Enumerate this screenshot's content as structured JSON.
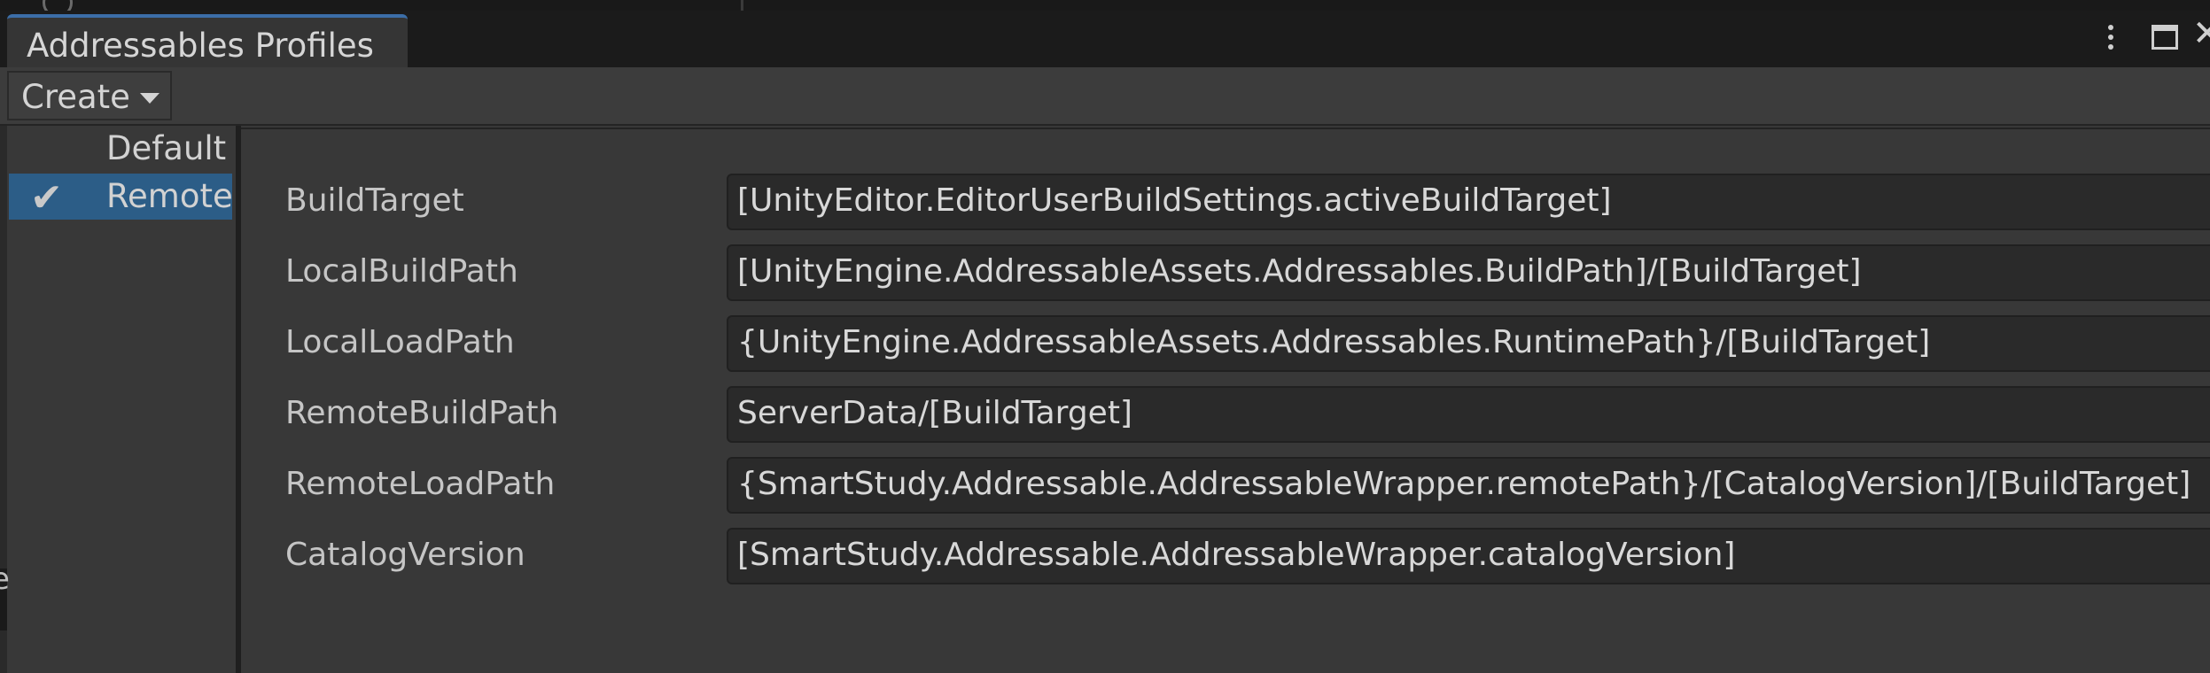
{
  "window": {
    "tab_title": "Addressables Profiles"
  },
  "toolbar": {
    "create_label": "Create"
  },
  "sidebar_edge_char": "e",
  "profiles": [
    {
      "label": "Default",
      "selected": false
    },
    {
      "label": "Remote",
      "selected": true
    }
  ],
  "variables": [
    {
      "name": "BuildTarget",
      "value": "[UnityEditor.EditorUserBuildSettings.activeBuildTarget]"
    },
    {
      "name": "LocalBuildPath",
      "value": "[UnityEngine.AddressableAssets.Addressables.BuildPath]/[BuildTarget]"
    },
    {
      "name": "LocalLoadPath",
      "value": "{UnityEngine.AddressableAssets.Addressables.RuntimePath}/[BuildTarget]"
    },
    {
      "name": "RemoteBuildPath",
      "value": "ServerData/[BuildTarget]"
    },
    {
      "name": "RemoteLoadPath",
      "value": "{SmartStudy.Addressable.AddressableWrapper.remotePath}/[CatalogVersion]/[BuildTarget]"
    },
    {
      "name": "CatalogVersion",
      "value": "[SmartStudy.Addressable.AddressableWrapper.catalogVersion]"
    }
  ],
  "colors": {
    "selection": "#2c5d87",
    "tab_accent": "#3c6ea8"
  }
}
